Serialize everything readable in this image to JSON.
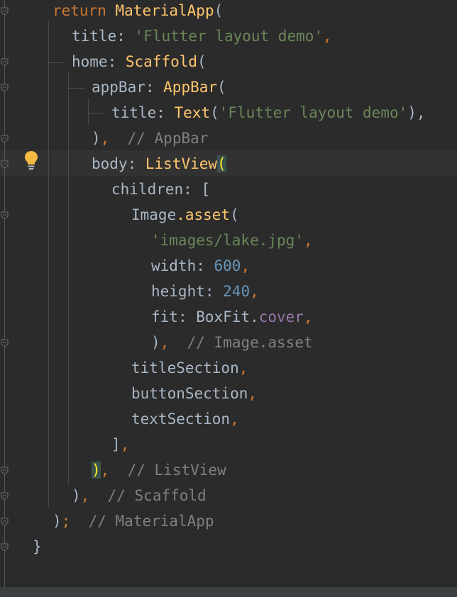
{
  "code": {
    "lines": [
      [
        {
          "t": "return ",
          "c": "kw"
        },
        {
          "t": "MaterialApp",
          "c": "cls"
        },
        {
          "t": "(",
          "c": "plain"
        }
      ],
      [
        {
          "t": "title",
          "c": "plain"
        },
        {
          "t": ": ",
          "c": "plain"
        },
        {
          "t": "'Flutter layout demo'",
          "c": "str"
        },
        {
          "t": ",",
          "c": "punc"
        }
      ],
      [
        {
          "t": "home",
          "c": "plain"
        },
        {
          "t": ": ",
          "c": "plain"
        },
        {
          "t": "Scaffold",
          "c": "cls"
        },
        {
          "t": "(",
          "c": "plain"
        }
      ],
      [
        {
          "t": "appBar",
          "c": "plain"
        },
        {
          "t": ": ",
          "c": "plain"
        },
        {
          "t": "AppBar",
          "c": "cls"
        },
        {
          "t": "(",
          "c": "plain"
        }
      ],
      [
        {
          "t": "title",
          "c": "plain"
        },
        {
          "t": ": ",
          "c": "plain"
        },
        {
          "t": "Text",
          "c": "cls"
        },
        {
          "t": "(",
          "c": "plain"
        },
        {
          "t": "'Flutter layout demo'",
          "c": "str"
        },
        {
          "t": "),",
          "c": "plain"
        }
      ],
      [
        {
          "t": ")",
          "c": "plain"
        },
        {
          "t": ",",
          "c": "punc"
        },
        {
          "t": "  // AppBar",
          "c": "cmt"
        }
      ],
      [
        {
          "t": "body",
          "c": "plain"
        },
        {
          "t": ": ",
          "c": "plain"
        },
        {
          "t": "ListView",
          "c": "cls"
        },
        {
          "t": "(",
          "c": "hl"
        }
      ],
      [
        {
          "t": "children",
          "c": "plain"
        },
        {
          "t": ": [",
          "c": "plain"
        }
      ],
      [
        {
          "t": "Image",
          "c": "plain"
        },
        {
          "t": ".asset",
          "c": "cls"
        },
        {
          "t": "(",
          "c": "plain"
        }
      ],
      [
        {
          "t": "'images/lake.jpg'",
          "c": "str"
        },
        {
          "t": ",",
          "c": "punc"
        }
      ],
      [
        {
          "t": "width",
          "c": "plain"
        },
        {
          "t": ": ",
          "c": "plain"
        },
        {
          "t": "600",
          "c": "num"
        },
        {
          "t": ",",
          "c": "punc"
        }
      ],
      [
        {
          "t": "height",
          "c": "plain"
        },
        {
          "t": ": ",
          "c": "plain"
        },
        {
          "t": "240",
          "c": "num"
        },
        {
          "t": ",",
          "c": "punc"
        }
      ],
      [
        {
          "t": "fit",
          "c": "plain"
        },
        {
          "t": ": BoxFit.",
          "c": "plain"
        },
        {
          "t": "cover",
          "c": "prop"
        },
        {
          "t": ",",
          "c": "punc"
        }
      ],
      [
        {
          "t": ")",
          "c": "plain"
        },
        {
          "t": ",",
          "c": "punc"
        },
        {
          "t": "  // Image.asset",
          "c": "cmt"
        }
      ],
      [
        {
          "t": "titleSection",
          "c": "plain"
        },
        {
          "t": ",",
          "c": "punc"
        }
      ],
      [
        {
          "t": "buttonSection",
          "c": "plain"
        },
        {
          "t": ",",
          "c": "punc"
        }
      ],
      [
        {
          "t": "textSection",
          "c": "plain"
        },
        {
          "t": ",",
          "c": "punc"
        }
      ],
      [
        {
          "t": "]",
          "c": "plain"
        },
        {
          "t": ",",
          "c": "punc"
        }
      ],
      [
        {
          "t": ")",
          "c": "hl"
        },
        {
          "t": ",",
          "c": "punc"
        },
        {
          "t": "  // ListView",
          "c": "cmt"
        }
      ],
      [
        {
          "t": ")",
          "c": "plain"
        },
        {
          "t": ",",
          "c": "punc"
        },
        {
          "t": "  // Scaffold",
          "c": "cmt"
        }
      ],
      [
        {
          "t": ")",
          "c": "plain"
        },
        {
          "t": ";",
          "c": "punc"
        },
        {
          "t": "  // MaterialApp",
          "c": "cmt"
        }
      ],
      [
        {
          "t": "}",
          "c": "plain"
        }
      ]
    ]
  },
  "colors": {
    "background": "#2b2b2b",
    "keyword": "#cc7832",
    "class": "#ffc66d",
    "string": "#6a8759",
    "number": "#6897bb",
    "property": "#9876aa",
    "comment": "#808080",
    "plain": "#a9b7c6",
    "bracket_highlight": "#ffef28"
  },
  "icons": {
    "intention": "lightbulb-icon",
    "fold": "fold-marker-icon"
  }
}
